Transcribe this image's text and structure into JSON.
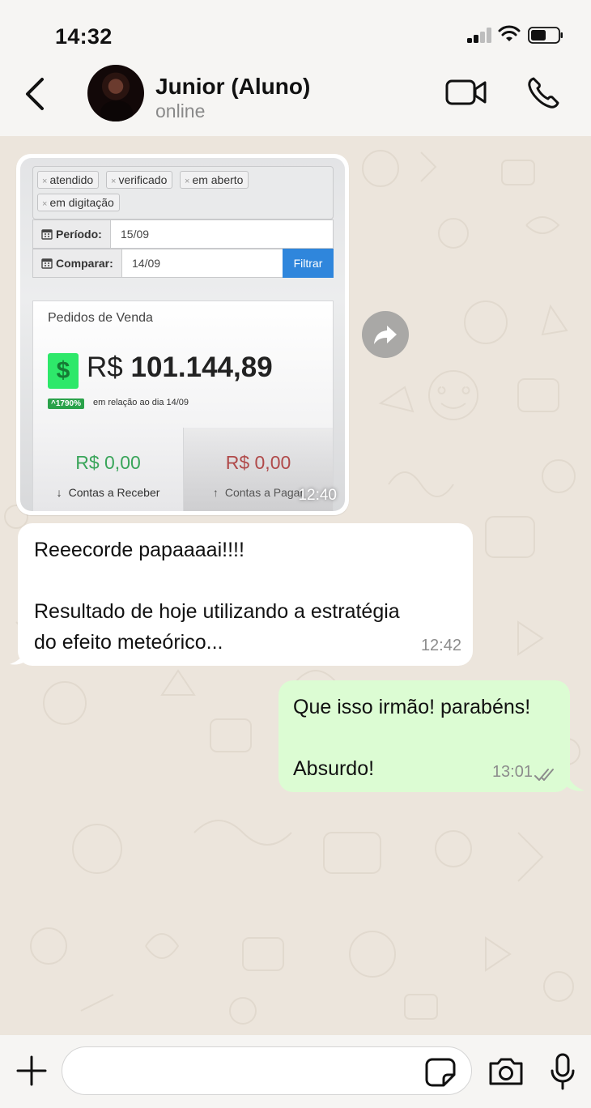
{
  "status_bar": {
    "time": "14:32"
  },
  "header": {
    "back_icon": "chevron-left-icon",
    "contact_name": "Junior (Aluno)",
    "contact_status": "online",
    "video_icon": "video-camera-icon",
    "phone_icon": "phone-icon"
  },
  "messages": {
    "image_message": {
      "time": "12:40",
      "screenshot": {
        "tags": [
          "atendido",
          "verificado",
          "em aberto",
          "em digitação"
        ],
        "periodo_label": "Período:",
        "periodo_value": "15/09",
        "comparar_label": "Comparar:",
        "comparar_value": "14/09",
        "filter_button": "Filtrar",
        "card_title": "Pedidos de Venda",
        "currency": "R$",
        "amount": "101.144,89",
        "dollar_symbol": "$",
        "percent": "^1790%",
        "percent_note": "em relação ao dia 14/09",
        "receber_value": "R$ 0,00",
        "receber_label": "Contas a Receber",
        "pagar_value": "R$ 0,00",
        "pagar_label": "Contas a Pagar"
      }
    },
    "received_text": {
      "lines": [
        "Reeecorde papaaaai!!!!",
        "",
        "Resultado de hoje utilizando a estratégia",
        "do efeito meteórico..."
      ],
      "time": "12:42"
    },
    "sent_text": {
      "lines": [
        "Que isso irmão! parabéns!",
        "",
        "Absurdo!"
      ],
      "time": "13:01",
      "status_icon": "double-check-icon"
    }
  },
  "input_bar": {
    "placeholder": "",
    "icons": [
      "plus-icon",
      "sticker-icon",
      "camera-icon",
      "microphone-icon"
    ]
  },
  "colors": {
    "sent_bubble": "#dcfcd3",
    "received_bubble": "#ffffff",
    "chat_background": "#ece5dc",
    "filter_button": "#2f86dc",
    "dollar_badge": "#2ee86a",
    "receber_value": "#3aa55a",
    "pagar_value": "#b04a4a"
  }
}
